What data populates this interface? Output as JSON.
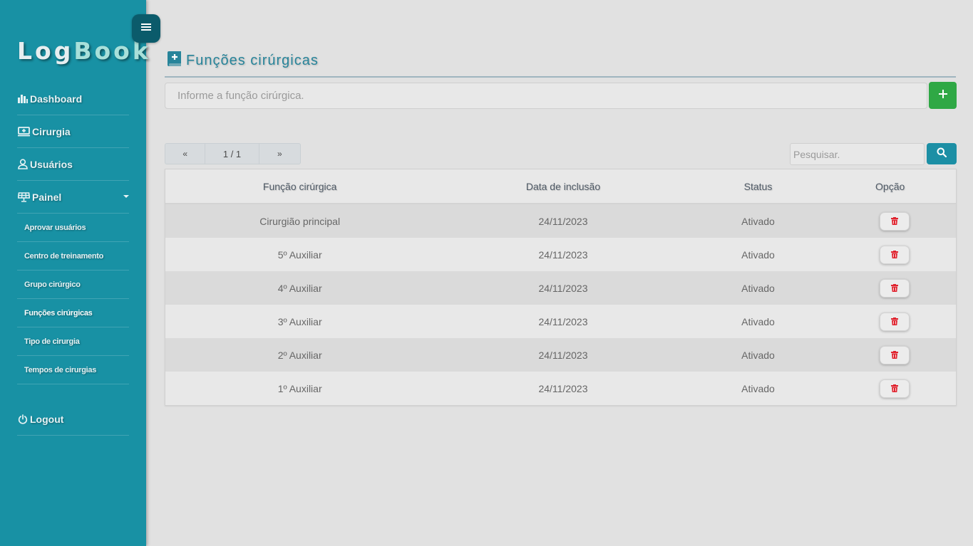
{
  "logo": {
    "part1": "Log",
    "part2": "Book"
  },
  "sidebar": {
    "items": [
      {
        "label": "Dashboard",
        "icon": "bar-chart-icon"
      },
      {
        "label": "Cirurgia",
        "icon": "monitor-plus-icon"
      },
      {
        "label": "Usuários",
        "icon": "user-icon"
      },
      {
        "label": "Painel",
        "icon": "solar-panel-icon"
      }
    ],
    "sub_items": [
      {
        "label": "Aprovar usuários"
      },
      {
        "label": "Centro de treinamento"
      },
      {
        "label": "Grupo cirúrgico"
      },
      {
        "label": "Funções cirúrgicas",
        "active": true
      },
      {
        "label": "Tipo de cirurgia"
      },
      {
        "label": "Tempos de cirurgias"
      }
    ],
    "logout": {
      "label": "Logout",
      "icon": "power-icon"
    }
  },
  "page": {
    "title": "Funções cirúrgicas",
    "title_icon": "book-plus-icon",
    "add_placeholder": "Informe a função cirúrgica.",
    "add_button_icon": "plus-icon"
  },
  "pagination": {
    "prev": "«",
    "page": "1 / 1",
    "next": "»"
  },
  "search": {
    "placeholder": "Pesquisar.",
    "icon": "search-icon"
  },
  "table": {
    "headers": [
      "Função cirúrgica",
      "Data de inclusão",
      "Status",
      "Opção"
    ],
    "rows": [
      {
        "funcao": "Cirurgião principal",
        "data": "24/11/2023",
        "status": "Ativado"
      },
      {
        "funcao": "5º Auxiliar",
        "data": "24/11/2023",
        "status": "Ativado"
      },
      {
        "funcao": "4º Auxiliar",
        "data": "24/11/2023",
        "status": "Ativado"
      },
      {
        "funcao": "3º Auxiliar",
        "data": "24/11/2023",
        "status": "Ativado"
      },
      {
        "funcao": "2º Auxiliar",
        "data": "24/11/2023",
        "status": "Ativado"
      },
      {
        "funcao": "1º Auxiliar",
        "data": "24/11/2023",
        "status": "Ativado"
      }
    ],
    "action_icon": "trash-icon"
  },
  "colors": {
    "sidebar": "#1891a4",
    "accent": "#27849a",
    "add_button": "#2fa845",
    "delete_icon": "#e0242f"
  }
}
